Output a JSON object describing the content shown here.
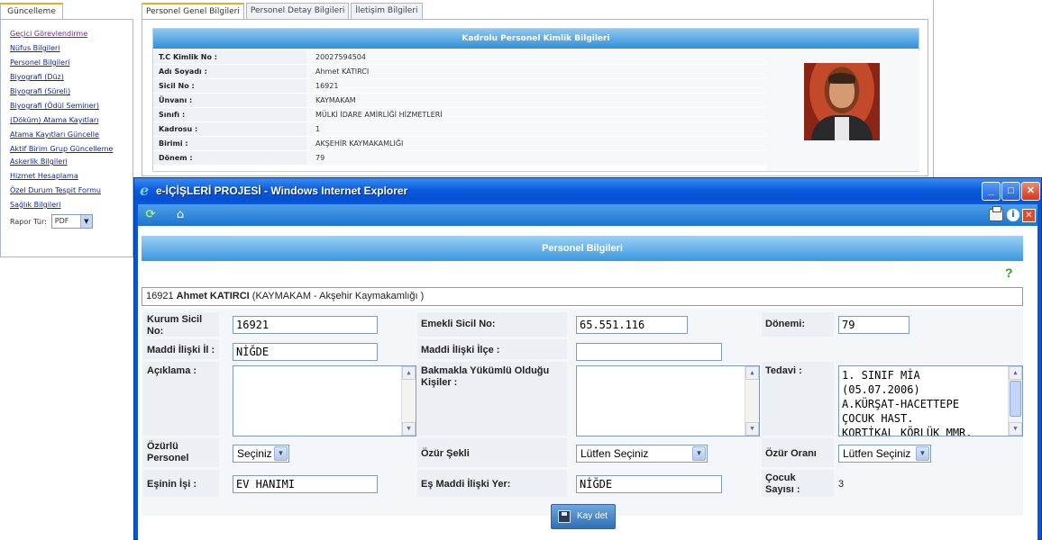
{
  "left_panel": {
    "tab_label": "Güncelleme",
    "links": [
      "Geçici Görevlendirme",
      "Nüfus Bilgileri",
      "Personel Bilgileri",
      "Biyografi (Düz)",
      "Biyografi (Süreli)",
      "Biyografi (Ödül Seminer)",
      "(Döküm) Atama Kayıtları",
      "Atama Kayıtları Güncelle",
      "Aktif Birim Grup Güncelleme",
      "Askerlik Bilgileri",
      "Hizmet Hesaplama",
      "Özel Durum Tespit Formu",
      "Sağlık Bilgileri"
    ],
    "rapor_label": "Rapor Tür:",
    "rapor_value": "PDF"
  },
  "main": {
    "tabs": [
      "Personel Genel Bilgileri",
      "Personel Detay Bilgileri",
      "İletişim Bilgileri"
    ],
    "card_title": "Kadrolu Personel Kimlik Bilgileri",
    "rows": [
      {
        "label": "T.C Kimlik No :",
        "value": "20027594504"
      },
      {
        "label": "Adı Soyadı :",
        "value": "Ahmet KATIRCI"
      },
      {
        "label": "Sicil No :",
        "value": "16921"
      },
      {
        "label": "Ünvanı :",
        "value": "KAYMAKAM"
      },
      {
        "label": "Sınıfı :",
        "value": "MÜLKİ İDARE AMİRLİĞİ HİZMETLERİ"
      },
      {
        "label": "Kadrosu :",
        "value": "1"
      },
      {
        "label": "Birimi :",
        "value": "AKŞEHİR KAYMAKAMLIĞI"
      },
      {
        "label": "Dönem :",
        "value": "79"
      }
    ]
  },
  "ie_window": {
    "title": "e-İÇİŞLERİ PROJESİ - Windows Internet Explorer",
    "header": "Personel Bilgileri",
    "name_bar": {
      "sicil": "16921 ",
      "name": "Ahmet KATIRCI",
      "detail": " (KAYMAKAM - Akşehir Kaymakamlığı )"
    },
    "form": {
      "kurum_sicil_label": "Kurum Sicil No:",
      "kurum_sicil_value": "16921",
      "emekli_sicil_label": "Emekli Sicil No:",
      "emekli_sicil_value": "65.551.116",
      "donemi_label": "Dönemi:",
      "donemi_value": "79",
      "maddi_il_label": "Maddi İlişki İl :",
      "maddi_il_value": "NİĞDE",
      "maddi_ilce_label": "Maddi İlişki İlçe :",
      "maddi_ilce_value": "",
      "aciklama_label": "Açıklama :",
      "aciklama_value": "",
      "bakmakla_label": "Bakmakla Yükümlü Olduğu Kişiler :",
      "bakmakla_value": "",
      "tedavi_label": "Tedavi :",
      "tedavi_lines": [
        "1. SINIF MİA",
        "(05.07.2006)",
        "A.KÜRŞAT-HACETTEPE",
        "ÇOCUK HAST.",
        "KORTİKAL KÖRLÜK MMR."
      ],
      "ozurlu_label": "Özürlü Personel",
      "ozurlu_value": "Seçiniz",
      "ozur_sekli_label": "Özür Şekli",
      "ozur_sekli_value": "Lütfen Seçiniz",
      "ozur_orani_label": "Özür Oranı",
      "ozur_orani_value": "Lütfen Seçiniz",
      "esinin_isi_label": "Eşinin İşi :",
      "esinin_isi_value": "EV HANIMI",
      "es_maddi_label": "Eş Maddi İlişki Yer:",
      "es_maddi_value": "NİĞDE",
      "cocuk_label": "Çocuk Sayısı :",
      "cocuk_value": "3"
    },
    "save_label": "Kay det"
  }
}
